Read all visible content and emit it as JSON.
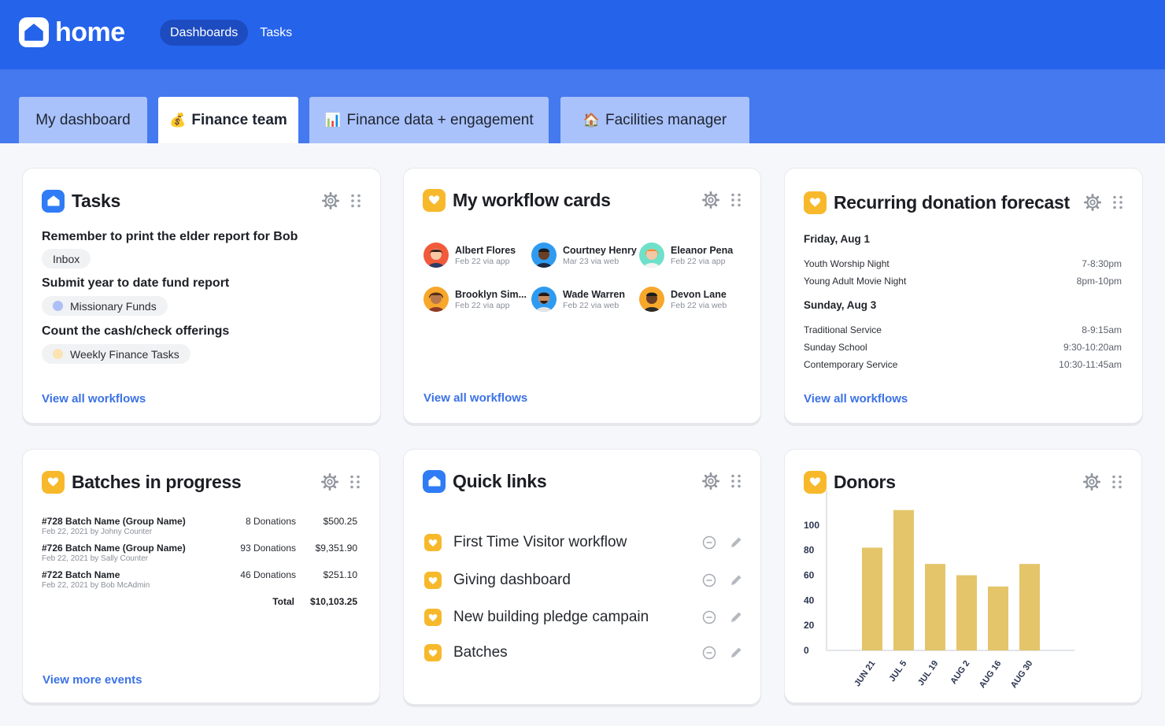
{
  "header": {
    "logo_text": "home",
    "nav": [
      {
        "label": "Dashboards",
        "active": true
      },
      {
        "label": "Tasks",
        "active": false
      }
    ],
    "brand_color": "#2563eb"
  },
  "tabs": [
    {
      "label": "My dashboard",
      "emoji": "",
      "active": false
    },
    {
      "label": "Finance team",
      "emoji": "💰",
      "active": true
    },
    {
      "label": "Finance data + engagement",
      "emoji": "📊",
      "active": false
    },
    {
      "label": "Facilities manager",
      "emoji": "🏠",
      "active": false
    }
  ],
  "tasks_card": {
    "title": "Tasks",
    "items": [
      {
        "title": "Remember to print the elder report for Bob",
        "tag": "Inbox",
        "dot_color": ""
      },
      {
        "title": "Submit year to date fund report",
        "tag": "Missionary Funds",
        "dot_color": "#aebff5"
      },
      {
        "title": "Count the cash/check offerings",
        "tag": "Weekly Finance Tasks",
        "dot_color": "#fbe3b4"
      }
    ],
    "link": "View all workflows"
  },
  "workflow_card": {
    "title": "My workflow cards",
    "people": [
      {
        "name": "Albert Flores",
        "meta": "Feb 22 via app",
        "color": "#f25a3c"
      },
      {
        "name": "Courtney Henry",
        "meta": "Mar 23 via web",
        "color": "#2f9bf0"
      },
      {
        "name": "Eleanor Pena",
        "meta": "Feb 22 via app",
        "color": "#6fe0c9"
      },
      {
        "name": "Brooklyn Sim...",
        "meta": "Feb 22 via app",
        "color": "#f7a72b"
      },
      {
        "name": "Wade Warren",
        "meta": "Feb 22 via web",
        "color": "#2f9bf0"
      },
      {
        "name": "Devon Lane",
        "meta": "Feb 22 via web",
        "color": "#f7a72b"
      }
    ],
    "link": "View all workflows"
  },
  "forecast_card": {
    "title": "Recurring donation forecast",
    "days": [
      {
        "day": "Friday, Aug 1",
        "events": [
          {
            "name": "Youth Worship Night",
            "time": "7-8:30pm"
          },
          {
            "name": "Young Adult Movie Night",
            "time": "8pm-10pm"
          }
        ]
      },
      {
        "day": "Sunday, Aug 3",
        "events": [
          {
            "name": "Traditional Service",
            "time": "8-9:15am"
          },
          {
            "name": "Sunday School",
            "time": "9:30-10:20am"
          },
          {
            "name": "Contemporary Service",
            "time": "10:30-11:45am"
          }
        ]
      }
    ],
    "link": "View all workflows"
  },
  "batches_card": {
    "title": "Batches in progress",
    "rows": [
      {
        "name": "#728 Batch Name (Group Name)",
        "sub": "Feb 22, 2021 by Johny Counter",
        "count": "8 Donations",
        "amount": "$500.25"
      },
      {
        "name": "#726 Batch Name (Group Name)",
        "sub": "Feb 22, 2021 by Sally Counter",
        "count": "93 Donations",
        "amount": "$9,351.90"
      },
      {
        "name": "#722 Batch Name",
        "sub": "Feb 22, 2021 by Bob McAdmin",
        "count": "46 Donations",
        "amount": "$251.10"
      }
    ],
    "total_label": "Total",
    "total_value": "$10,103.25",
    "link": "View more events"
  },
  "quicklinks_card": {
    "title": "Quick links",
    "items": [
      {
        "label": "First Time Visitor workflow"
      },
      {
        "label": "Giving dashboard"
      },
      {
        "label": "New building pledge campain"
      },
      {
        "label": "Batches"
      }
    ]
  },
  "donors_card": {
    "title": "Donors"
  },
  "chart_data": {
    "type": "bar",
    "categories": [
      "JUN 21",
      "JUL 5",
      "JUL 19",
      "AUG 2",
      "AUG 16",
      "AUG 30"
    ],
    "values": [
      82,
      112,
      69,
      60,
      51,
      69
    ],
    "yticks": [
      "0",
      "20",
      "40",
      "60",
      "80",
      "100"
    ],
    "ylim": [
      0,
      120
    ],
    "bar_color": "#e4c56a",
    "grid": false
  }
}
